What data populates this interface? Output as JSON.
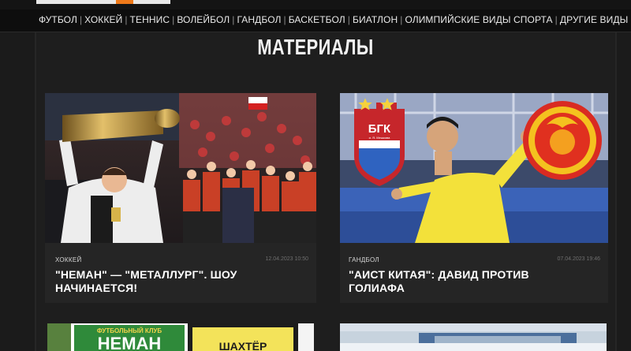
{
  "nav": {
    "items": [
      "ФУТБОЛ",
      "ХОККЕЙ",
      "ТЕННИС",
      "ВОЛЕЙБОЛ",
      "ГАНДБОЛ",
      "БАСКЕТБОЛ",
      "БИАТЛОН",
      "ОЛИМПИЙСКИЕ ВИДЫ СПОРТА",
      "ДРУГИЕ ВИДЫ СПОРТА"
    ],
    "separator": "|"
  },
  "section": {
    "title": "МАТЕРИАЛЫ"
  },
  "articles": [
    {
      "category": "ХОККЕЙ",
      "date": "12.04.2023 10:50",
      "headline": "\"НЕМАН\" — \"МЕТАЛЛУРГ\". ШОУ НАЧИНАЕТСЯ!"
    },
    {
      "category": "ГАНДБОЛ",
      "date": "07.04.2023 19:46",
      "headline": "\"АИСТ КИТАЯ\": ДАВИД ПРОТИВ ГОЛИАФА",
      "logo_left_text": "БГК",
      "logo_left_sub": "и. Я. Мешкова"
    },
    {
      "logo_top_text": "ФУТБОЛЬНЫЙ КЛУБ",
      "logo_main_text": "НЕМАН",
      "logo_right_text": "ШАХТЁР"
    },
    {}
  ],
  "colors": {
    "accent": "#f07a1a",
    "background": "#1b1b1b",
    "card": "#252525"
  }
}
